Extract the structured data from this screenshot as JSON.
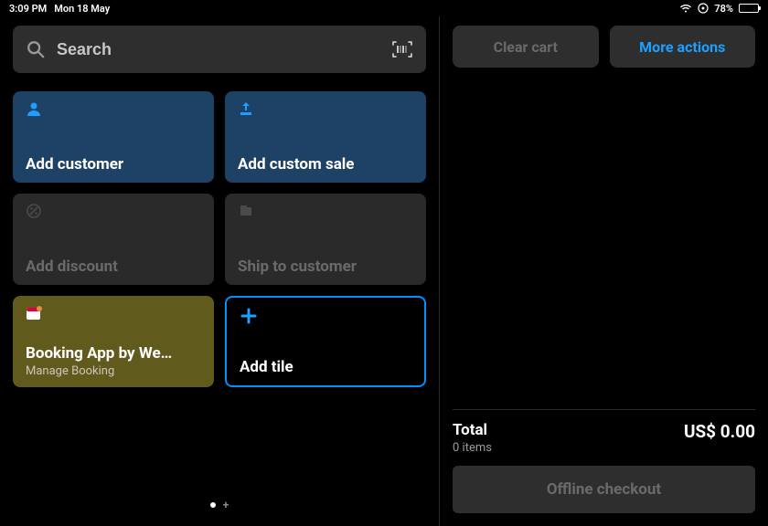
{
  "status_bar": {
    "time": "3:09 PM",
    "date": "Mon 18 May",
    "battery_pct": "78%"
  },
  "search": {
    "placeholder": "Search"
  },
  "tiles": {
    "add_customer": "Add customer",
    "add_custom_sale": "Add custom sale",
    "add_discount": "Add discount",
    "ship_to_customer": "Ship to customer",
    "booking_title": "Booking App by We…",
    "booking_sub": "Manage Booking",
    "add_tile": "Add tile"
  },
  "cart": {
    "clear": "Clear cart",
    "more": "More actions",
    "total_label": "Total",
    "items_sub": "0 items",
    "amount": "US$ 0.00",
    "checkout": "Offline checkout"
  }
}
